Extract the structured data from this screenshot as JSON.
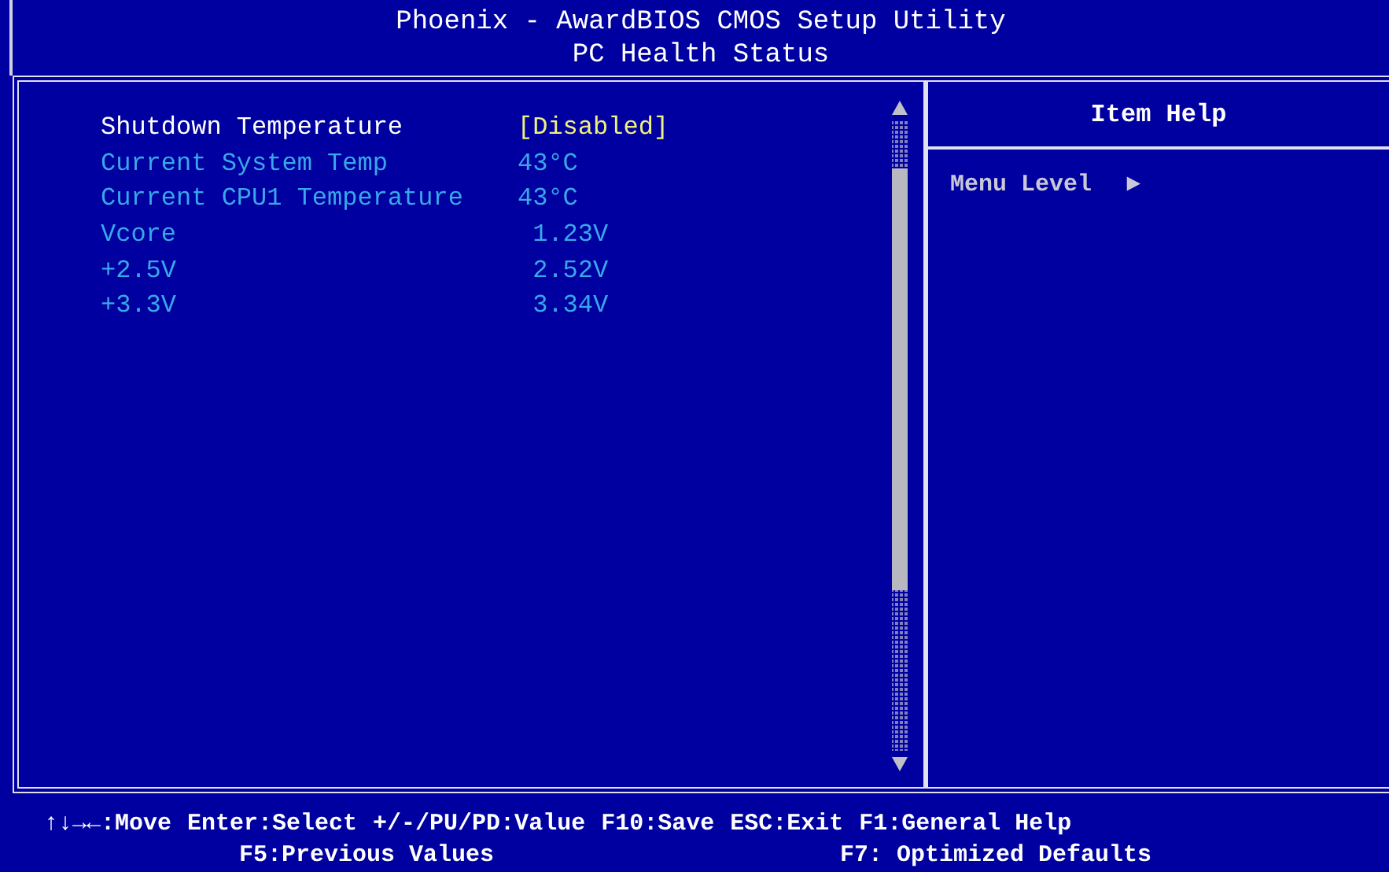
{
  "header": {
    "title": "Phoenix - AwardBIOS CMOS Setup Utility",
    "subtitle": "PC Health Status"
  },
  "items": [
    {
      "kind": "setting",
      "label": "Shutdown Temperature",
      "value": "[Disabled]",
      "selected": true
    },
    {
      "kind": "info",
      "label": "Current System Temp",
      "value": "43°C"
    },
    {
      "kind": "info",
      "label": "Current CPU1 Temperature",
      "value": "43°C"
    },
    {
      "kind": "info",
      "label": "Vcore",
      "value": " 1.23V"
    },
    {
      "kind": "info",
      "label": "+2.5V",
      "value": " 2.52V"
    },
    {
      "kind": "info",
      "label": "+3.3V",
      "value": " 3.34V"
    }
  ],
  "help": {
    "title": "Item Help",
    "menu_level": "Menu Level",
    "level_marker": "►"
  },
  "footer": {
    "lines": [
      [
        "↑↓→←:Move",
        "Enter:Select",
        "+/-/PU/PD:Value",
        "F10:Save",
        "ESC:Exit",
        "F1:General Help"
      ],
      [
        "F5:Previous Values",
        "F7: Optimized Defaults"
      ]
    ]
  }
}
